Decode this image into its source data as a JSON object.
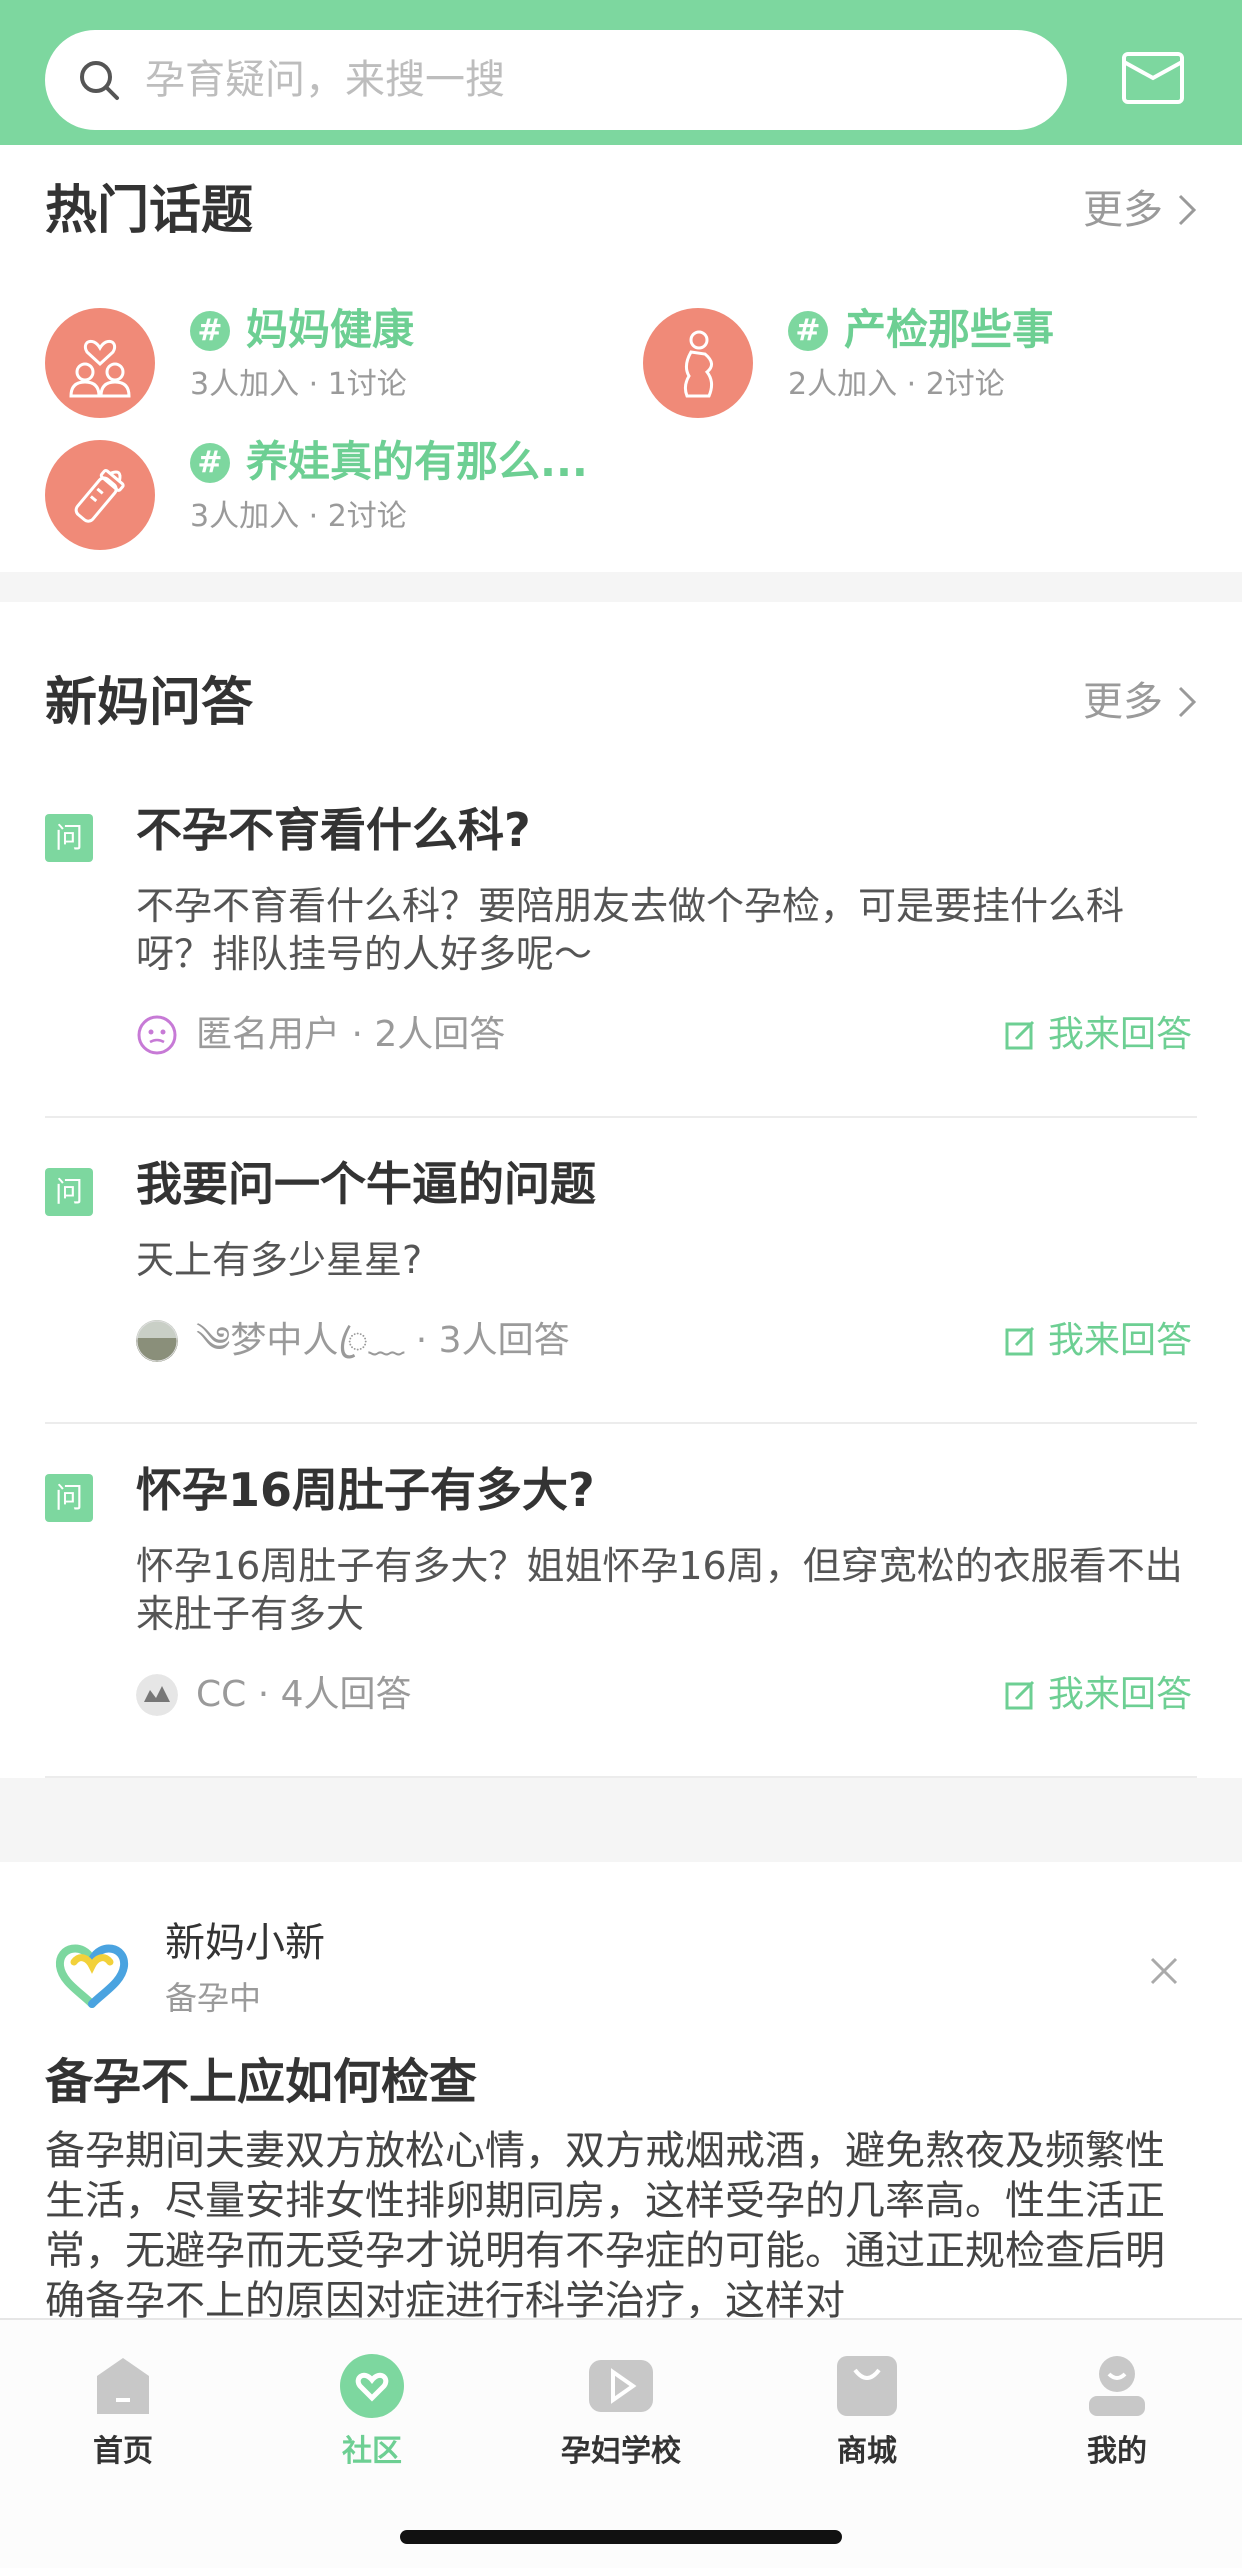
{
  "search": {
    "placeholder": "孕育疑问，来搜一搜",
    "icon": "search-icon"
  },
  "header": {
    "mail_icon": "mail-icon"
  },
  "hot_topics": {
    "title": "热门话题",
    "more": "更多",
    "items": [
      {
        "name": "妈妈健康",
        "meta": "3人加入 · 1讨论",
        "icon": "mother-child-icon"
      },
      {
        "name": "产检那些事",
        "meta": "2人加入 · 2讨论",
        "icon": "pregnant-woman-icon"
      },
      {
        "name": "养娃真的有那么...",
        "meta": "3人加入 · 2讨论",
        "icon": "baby-bottle-icon"
      }
    ],
    "hash_symbol": "#"
  },
  "qa": {
    "title": "新妈问答",
    "more": "更多",
    "badge": "问",
    "answer_label": "我来回答",
    "items": [
      {
        "title": "不孕不育看什么科?",
        "body": "不孕不育看什么科？要陪朋友去做个孕检，可是要挂什么科呀？排队挂号的人好多呢～",
        "user": "匿名用户 · 2人回答"
      },
      {
        "title": "我要问一个牛逼的问题",
        "body": "天上有多少星星?",
        "user": "༄梦中人ꦿ﹏ · 3人回答"
      },
      {
        "title": "怀孕16周肚子有多大?",
        "body": "怀孕16周肚子有多大？姐姐怀孕16周，但穿宽松的衣服看不出来肚子有多大",
        "user": "CC · 4人回答"
      }
    ]
  },
  "feed": {
    "author": "新妈小新",
    "stage": "备孕中",
    "title": "备孕不上应如何检查",
    "body": "备孕期间夫妻双方放松心情，双方戒烟戒酒，避免熬夜及频繁性生活，尽量安排女性排卵期同房，这样受孕的几率高。性生活正常，无避孕而无受孕才说明有不孕症的可能。通过正规检查后明确备孕不上的原因对症进行科学治疗，这样对"
  },
  "tabbar": {
    "active": "社区",
    "items": [
      {
        "label": "首页",
        "icon": "home-icon"
      },
      {
        "label": "社区",
        "icon": "community-heart-icon"
      },
      {
        "label": "孕妇学校",
        "icon": "video-play-icon"
      },
      {
        "label": "商城",
        "icon": "shopping-bag-icon"
      },
      {
        "label": "我的",
        "icon": "profile-icon"
      }
    ]
  },
  "colors": {
    "accent": "#7dd79f",
    "accent_text": "#6dcf93",
    "topic_avatar": "#f08a78"
  }
}
